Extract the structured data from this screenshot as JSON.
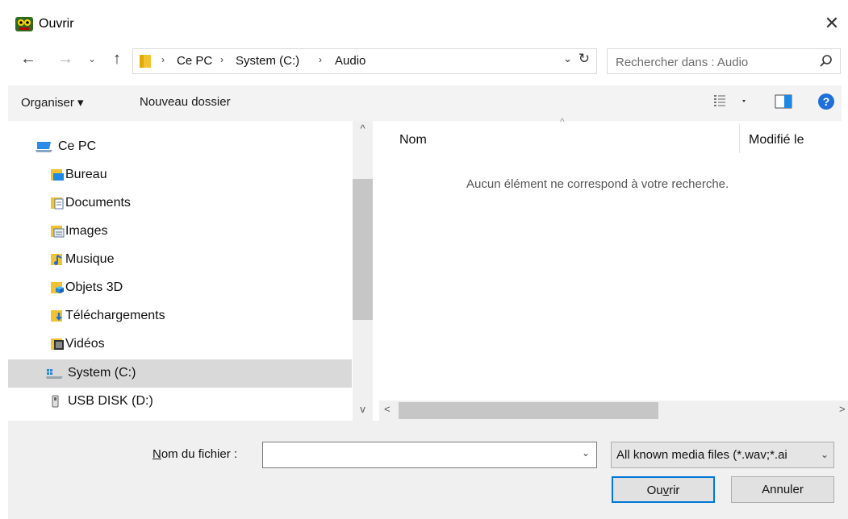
{
  "window": {
    "title": "Ouvrir",
    "close_glyph": "✕"
  },
  "nav": {
    "back": "←",
    "forward": "→",
    "recent": "⌄",
    "up": "↑"
  },
  "address": {
    "crumbs": [
      "Ce PC",
      "System (C:)",
      "Audio"
    ],
    "separator": "›",
    "dropdown": "⌄",
    "refresh": "↻"
  },
  "search": {
    "placeholder": "Rechercher dans : Audio"
  },
  "toolbar": {
    "organize": "Organiser ▾",
    "new_folder": "Nouveau dossier"
  },
  "sidebar": {
    "items": [
      {
        "label": "Ce PC",
        "icon": "pc-icon"
      },
      {
        "label": "Bureau",
        "icon": "desktop-folder-icon"
      },
      {
        "label": "Documents",
        "icon": "documents-folder-icon"
      },
      {
        "label": "Images",
        "icon": "images-folder-icon"
      },
      {
        "label": "Musique",
        "icon": "music-folder-icon"
      },
      {
        "label": "Objets 3D",
        "icon": "3d-objects-folder-icon"
      },
      {
        "label": "Téléchargements",
        "icon": "downloads-folder-icon"
      },
      {
        "label": "Vidéos",
        "icon": "videos-folder-icon"
      },
      {
        "label": "System (C:)",
        "icon": "system-drive-icon",
        "selected": true
      },
      {
        "label": "USB DISK (D:)",
        "icon": "usb-drive-icon"
      }
    ]
  },
  "filelist": {
    "columns": [
      "Nom",
      "Modifié le"
    ],
    "sort_glyph": "^",
    "empty_message": "Aucun élément ne correspond à votre recherche."
  },
  "scroll": {
    "up": "^",
    "down": "v",
    "left": "<",
    "right": ">"
  },
  "footer": {
    "filename_label_prefix": "N",
    "filename_label_rest": "om du fichier :",
    "filename_value": "",
    "filename_dd": "⌄",
    "filetype": "All known media files (*.wav;*.ai",
    "filetype_dd": "⌄",
    "open_prefix": "Ou",
    "open_accel": "v",
    "open_suffix": "rir",
    "cancel": "Annuler"
  },
  "colors": {
    "accent": "#0078d7",
    "toolbar_bg": "#f3f3f3",
    "selected_bg": "#d9d9d9",
    "folder_yellow": "#f0c040"
  }
}
